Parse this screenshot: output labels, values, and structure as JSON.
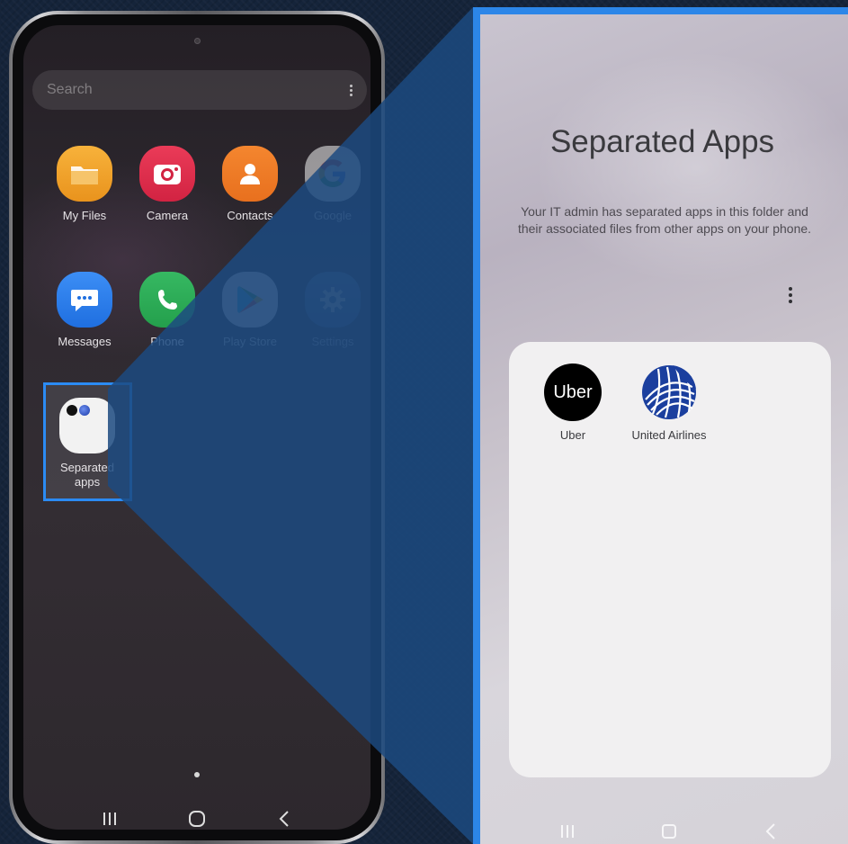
{
  "phone": {
    "search_placeholder": "Search",
    "apps": [
      {
        "label": "My Files",
        "icon": "folder-icon",
        "color": "#f0a42a"
      },
      {
        "label": "Camera",
        "icon": "camera-icon",
        "color": "#e0314f"
      },
      {
        "label": "Contacts",
        "icon": "person-icon",
        "color": "#ef7b27"
      },
      {
        "label": "Google",
        "icon": "google-icon",
        "color": "#ffffff"
      },
      {
        "label": "Messages",
        "icon": "message-icon",
        "color": "#2b7ff0"
      },
      {
        "label": "Phone",
        "icon": "phone-icon",
        "color": "#2fae57"
      },
      {
        "label": "Play Store",
        "icon": "play-store-icon",
        "color": "#ffffff"
      },
      {
        "label": "Settings",
        "icon": "gear-icon",
        "color": "#5b7ca8"
      }
    ],
    "separated_apps": {
      "label_line1": "Separated",
      "label_line2": "apps"
    },
    "nav": {
      "recents": "recents-icon",
      "home": "home-icon",
      "back": "back-icon"
    }
  },
  "panel": {
    "title": "Separated Apps",
    "description": "Your IT admin has separated apps in this folder and their associated files from other apps on your phone.",
    "apps": [
      {
        "label": "Uber",
        "icon_text": "Uber"
      },
      {
        "label": "United Airlines"
      }
    ]
  },
  "colors": {
    "highlight": "#2b8bf3",
    "background": "#15243a",
    "wedge": "#1c4a80"
  }
}
